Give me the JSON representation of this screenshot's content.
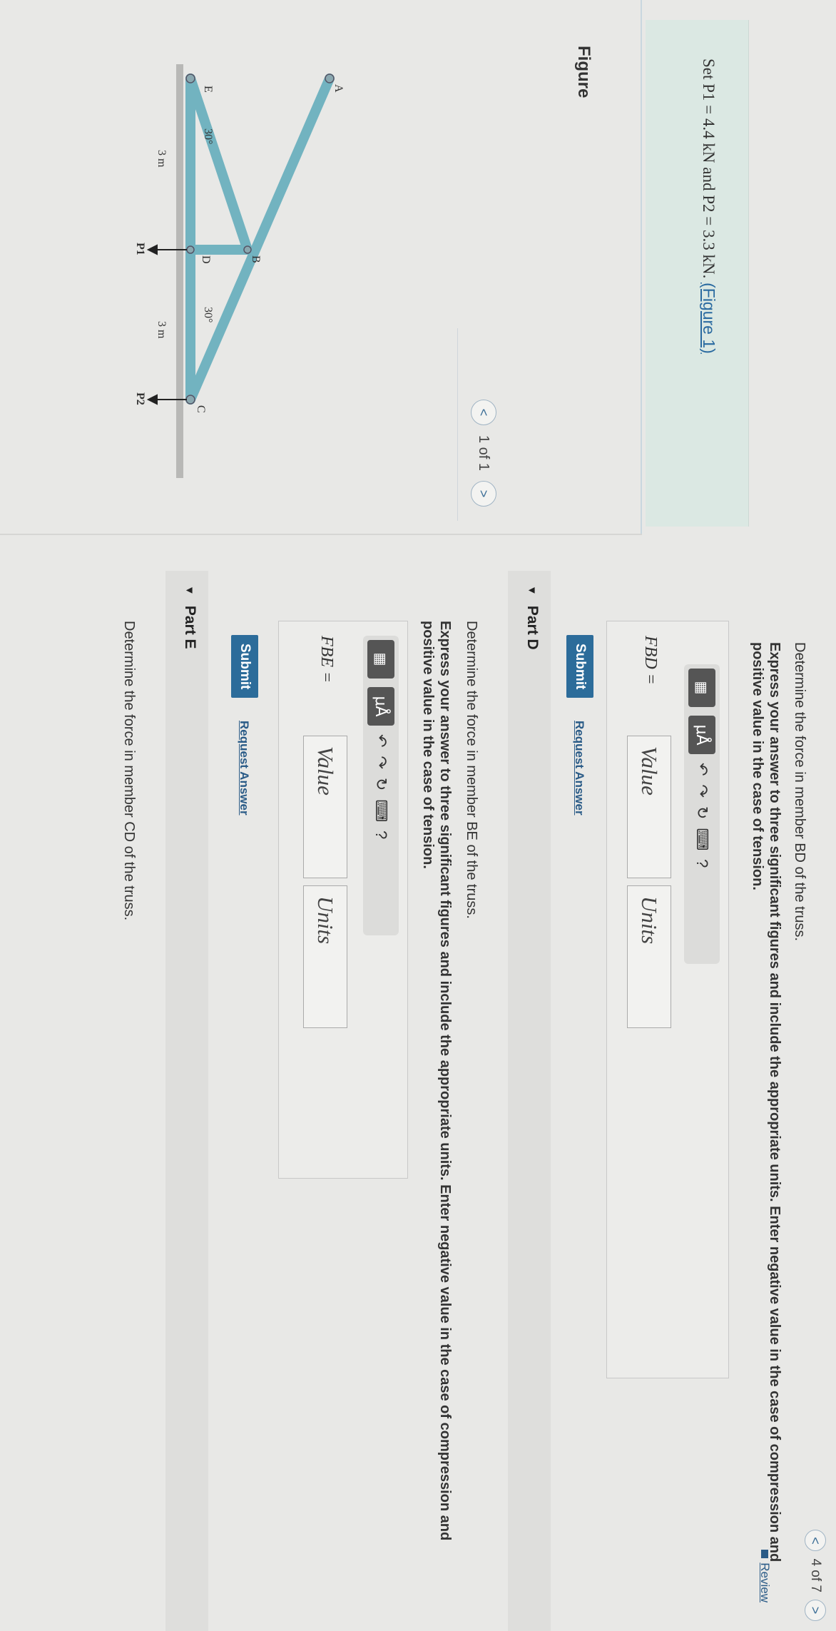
{
  "nav": {
    "position": "4 of 7",
    "prev": "<",
    "next": ">",
    "review": "Review"
  },
  "given": {
    "prefix": "Set ",
    "p1": "P1 = 4.4 kN",
    "mid": " and ",
    "p2": "P2 = 3.3 kN",
    "sep": ". ",
    "link": "(Figure 1)"
  },
  "figure": {
    "title": "Figure",
    "pager": "1 of 1",
    "prev": "<",
    "next": ">",
    "labels": {
      "A": "A",
      "B": "B",
      "C": "C",
      "D": "D",
      "E": "E",
      "ang1": "30°",
      "ang2": "30°",
      "len1": "3 m",
      "len2": "3 m",
      "p1": "P1",
      "p2": "P2"
    }
  },
  "partC": {
    "question": "Determine the force in member BD of the truss.",
    "instructions": "Express your answer to three significant figures and include the appropriate units. Enter negative value in the case of compression and positive value in the case of tension.",
    "label": "FBD =",
    "value_placeholder": "Value",
    "units_placeholder": "Units",
    "submit": "Submit",
    "request": "Request Answer"
  },
  "partD": {
    "title": "Part D",
    "question": "Determine the force in member BE of the truss.",
    "instructions": "Express your answer to three significant figures and include the appropriate units. Enter negative value in the case of compression and positive value in the case of tension.",
    "label": "FBE =",
    "value_placeholder": "Value",
    "units_placeholder": "Units",
    "submit": "Submit",
    "request": "Request Answer"
  },
  "partE": {
    "title": "Part E",
    "question": "Determine the force in member CD of the truss."
  },
  "toolbar": {
    "mu": "μÅ",
    "undo": "↶",
    "redo": "↷",
    "reset": "↻",
    "keyboard": "⌨",
    "help": "?"
  },
  "colors": {
    "accent": "#2c6c9a",
    "truss": "#6fb0bd",
    "given_bg": "#dbe8e3"
  }
}
